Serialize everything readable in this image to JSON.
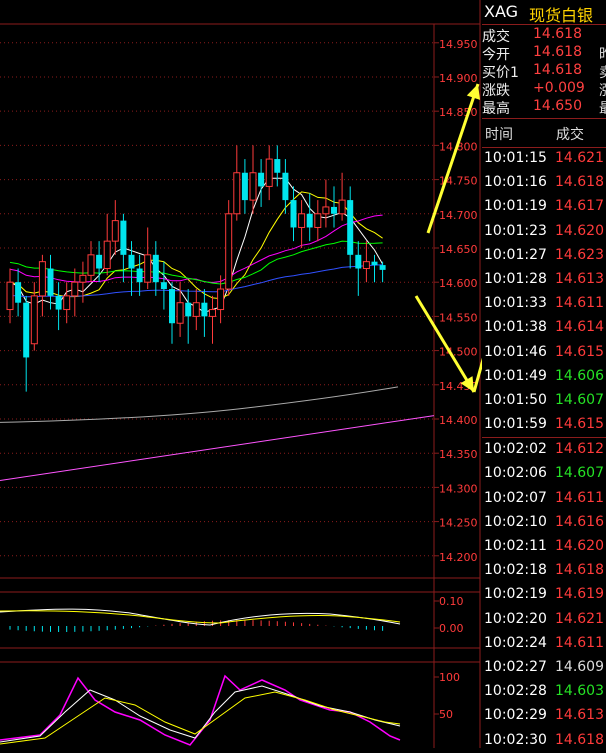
{
  "symbol": "XAG",
  "name": "现货白银",
  "quote": [
    {
      "label": "成交",
      "value": "14.618",
      "extra": ""
    },
    {
      "label": "今开",
      "value": "14.618",
      "extra": "昨"
    },
    {
      "label": "买价1",
      "value": "14.618",
      "extra": "卖"
    },
    {
      "label": "涨跌",
      "value": "+0.009",
      "extra": "涨"
    },
    {
      "label": "最高",
      "value": "14.650",
      "extra": "最"
    }
  ],
  "ticks_header": {
    "time": "时间",
    "price": "成交"
  },
  "ticks": [
    {
      "time": "10:01:15",
      "price": "14.621",
      "color": "red"
    },
    {
      "time": "10:01:16",
      "price": "14.618",
      "color": "red"
    },
    {
      "time": "10:01:19",
      "price": "14.617",
      "color": "red"
    },
    {
      "time": "10:01:23",
      "price": "14.620",
      "color": "red"
    },
    {
      "time": "10:01:27",
      "price": "14.623",
      "color": "red"
    },
    {
      "time": "10:01:28",
      "price": "14.613",
      "color": "red"
    },
    {
      "time": "10:01:33",
      "price": "14.611",
      "color": "red"
    },
    {
      "time": "10:01:38",
      "price": "14.614",
      "color": "red"
    },
    {
      "time": "10:01:46",
      "price": "14.615",
      "color": "red"
    },
    {
      "time": "10:01:49",
      "price": "14.606",
      "color": "green"
    },
    {
      "time": "10:01:50",
      "price": "14.607",
      "color": "green"
    },
    {
      "time": "10:01:59",
      "price": "14.615",
      "color": "red"
    },
    {
      "time": "10:02:02",
      "price": "14.612",
      "color": "red"
    },
    {
      "time": "10:02:06",
      "price": "14.607",
      "color": "green"
    },
    {
      "time": "10:02:07",
      "price": "14.611",
      "color": "red"
    },
    {
      "time": "10:02:10",
      "price": "14.616",
      "color": "red"
    },
    {
      "time": "10:02:11",
      "price": "14.620",
      "color": "red"
    },
    {
      "time": "10:02:18",
      "price": "14.618",
      "color": "red"
    },
    {
      "time": "10:02:19",
      "price": "14.619",
      "color": "red"
    },
    {
      "time": "10:02:20",
      "price": "14.621",
      "color": "red"
    },
    {
      "time": "10:02:24",
      "price": "14.611",
      "color": "red"
    },
    {
      "time": "10:02:27",
      "price": "14.609",
      "color": "white"
    },
    {
      "time": "10:02:28",
      "price": "14.603",
      "color": "green"
    },
    {
      "time": "10:02:29",
      "price": "14.613",
      "color": "red"
    },
    {
      "time": "10:02:30",
      "price": "14.618",
      "color": "red"
    }
  ],
  "price_axis": [
    "14.950",
    "14.900",
    "14.850",
    "14.800",
    "14.750",
    "14.700",
    "14.650",
    "14.600",
    "14.550",
    "14.500",
    "14.450",
    "14.400",
    "14.350",
    "14.300",
    "14.250",
    "14.200"
  ],
  "macd_axis": [
    "0.10",
    "0.00"
  ],
  "kdj_axis": [
    "100",
    "50"
  ],
  "colors": {
    "up": "#ff3b3b",
    "down": "#00e5ee",
    "grid": "#8b1c1c",
    "ma5": "#ffffff",
    "ma10": "#ffff00",
    "ma20": "#ff00ff",
    "ma30": "#00ff00",
    "ma60": "#3050ff",
    "ma120": "#aaaaaa",
    "ma250": "#ff55ff",
    "arrow": "#ffff33"
  },
  "candles": [
    {
      "o": 14.56,
      "c": 14.6,
      "h": 14.62,
      "l": 14.54
    },
    {
      "o": 14.6,
      "c": 14.57,
      "h": 14.62,
      "l": 14.55
    },
    {
      "o": 14.57,
      "c": 14.49,
      "h": 14.58,
      "l": 14.44
    },
    {
      "o": 14.51,
      "c": 14.58,
      "h": 14.6,
      "l": 14.5
    },
    {
      "o": 14.58,
      "c": 14.63,
      "h": 14.64,
      "l": 14.55
    },
    {
      "o": 14.62,
      "c": 14.58,
      "h": 14.64,
      "l": 14.56
    },
    {
      "o": 14.58,
      "c": 14.56,
      "h": 14.6,
      "l": 14.53
    },
    {
      "o": 14.56,
      "c": 14.58,
      "h": 14.6,
      "l": 14.54
    },
    {
      "o": 14.58,
      "c": 14.6,
      "h": 14.62,
      "l": 14.55
    },
    {
      "o": 14.6,
      "c": 14.61,
      "h": 14.63,
      "l": 14.57
    },
    {
      "o": 14.61,
      "c": 14.64,
      "h": 14.66,
      "l": 14.6
    },
    {
      "o": 14.64,
      "c": 14.62,
      "h": 14.66,
      "l": 14.6
    },
    {
      "o": 14.62,
      "c": 14.66,
      "h": 14.7,
      "l": 14.61
    },
    {
      "o": 14.66,
      "c": 14.69,
      "h": 14.72,
      "l": 14.64
    },
    {
      "o": 14.69,
      "c": 14.64,
      "h": 14.7,
      "l": 14.6
    },
    {
      "o": 14.64,
      "c": 14.62,
      "h": 14.66,
      "l": 14.58
    },
    {
      "o": 14.62,
      "c": 14.6,
      "h": 14.64,
      "l": 14.58
    },
    {
      "o": 14.6,
      "c": 14.64,
      "h": 14.68,
      "l": 14.59
    },
    {
      "o": 14.64,
      "c": 14.6,
      "h": 14.66,
      "l": 14.58
    },
    {
      "o": 14.6,
      "c": 14.59,
      "h": 14.63,
      "l": 14.56
    },
    {
      "o": 14.59,
      "c": 14.54,
      "h": 14.6,
      "l": 14.51
    },
    {
      "o": 14.54,
      "c": 14.57,
      "h": 14.6,
      "l": 14.52
    },
    {
      "o": 14.57,
      "c": 14.55,
      "h": 14.59,
      "l": 14.51
    },
    {
      "o": 14.55,
      "c": 14.57,
      "h": 14.59,
      "l": 14.53
    },
    {
      "o": 14.57,
      "c": 14.55,
      "h": 14.59,
      "l": 14.52
    },
    {
      "o": 14.55,
      "c": 14.56,
      "h": 14.58,
      "l": 14.51
    },
    {
      "o": 14.56,
      "c": 14.59,
      "h": 14.61,
      "l": 14.54
    },
    {
      "o": 14.59,
      "c": 14.7,
      "h": 14.72,
      "l": 14.58
    },
    {
      "o": 14.7,
      "c": 14.76,
      "h": 14.8,
      "l": 14.69
    },
    {
      "o": 14.76,
      "c": 14.72,
      "h": 14.78,
      "l": 14.7
    },
    {
      "o": 14.72,
      "c": 14.76,
      "h": 14.8,
      "l": 14.7
    },
    {
      "o": 14.76,
      "c": 14.74,
      "h": 14.78,
      "l": 14.71
    },
    {
      "o": 14.74,
      "c": 14.78,
      "h": 14.8,
      "l": 14.72
    },
    {
      "o": 14.78,
      "c": 14.76,
      "h": 14.8,
      "l": 14.74
    },
    {
      "o": 14.76,
      "c": 14.72,
      "h": 14.78,
      "l": 14.7
    },
    {
      "o": 14.72,
      "c": 14.68,
      "h": 14.74,
      "l": 14.66
    },
    {
      "o": 14.68,
      "c": 14.7,
      "h": 14.72,
      "l": 14.65
    },
    {
      "o": 14.7,
      "c": 14.68,
      "h": 14.73,
      "l": 14.66
    },
    {
      "o": 14.68,
      "c": 14.7,
      "h": 14.72,
      "l": 14.66
    },
    {
      "o": 14.7,
      "c": 14.71,
      "h": 14.75,
      "l": 14.68
    },
    {
      "o": 14.71,
      "c": 14.7,
      "h": 14.74,
      "l": 14.68
    },
    {
      "o": 14.7,
      "c": 14.72,
      "h": 14.76,
      "l": 14.69
    },
    {
      "o": 14.72,
      "c": 14.64,
      "h": 14.74,
      "l": 14.62
    },
    {
      "o": 14.64,
      "c": 14.62,
      "h": 14.66,
      "l": 14.58
    },
    {
      "o": 14.62,
      "c": 14.63,
      "h": 14.66,
      "l": 14.6
    },
    {
      "o": 14.63,
      "c": 14.625,
      "h": 14.64,
      "l": 14.6
    },
    {
      "o": 14.625,
      "c": 14.618,
      "h": 14.63,
      "l": 14.6
    }
  ]
}
